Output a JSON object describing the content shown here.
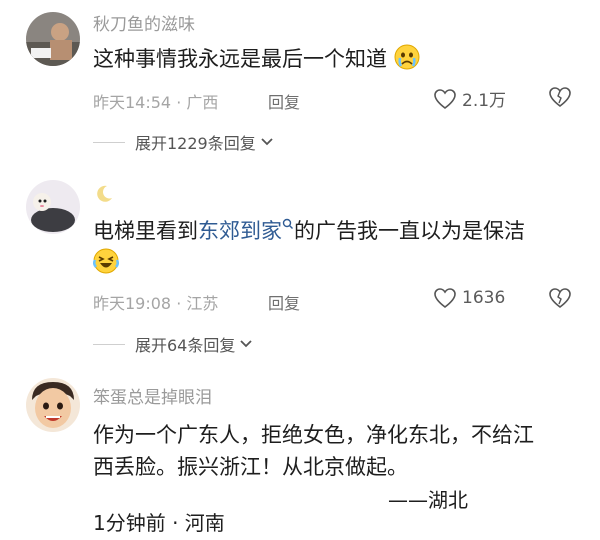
{
  "comments": [
    {
      "username": "秋刀鱼的滋味",
      "text": "这种事情我永远是最后一个知道",
      "emoji": "crying-face-icon",
      "time_location": "昨天14:54 · 广西",
      "reply_label": "回复",
      "like_count": "2.1万",
      "expand_label": "展开1229条回复"
    },
    {
      "username": "",
      "text_before_link": "电梯里看到",
      "link_text": "东郊到家",
      "text_after_link": "的广告我一直以为是保洁",
      "emoji": "laughing-tears-icon",
      "time_location": "昨天19:08 · 江苏",
      "reply_label": "回复",
      "like_count": "1636",
      "expand_label": "展开64条回复"
    },
    {
      "username": "笨蛋总是掉眼泪",
      "line1": "作为一个广东人，拒绝女色，净化东北，不给江",
      "line2": "西丢脸。振兴浙江！从北京做起。",
      "signature": "——湖北",
      "time_location": "1分钟前 · 河南"
    }
  ],
  "colors": {
    "username": "#9a9a9a",
    "meta": "#a5a5a5",
    "link": "#2f5b93",
    "text": "#1e1e1e"
  }
}
